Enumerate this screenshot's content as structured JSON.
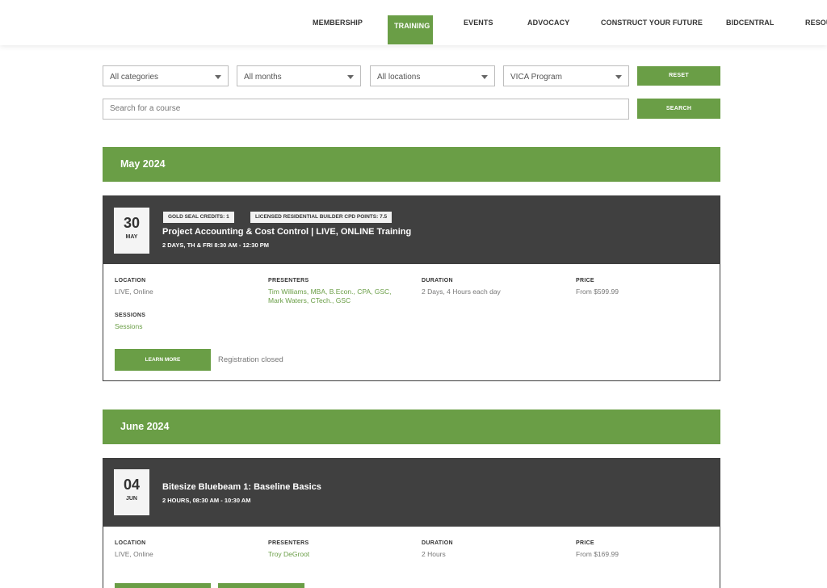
{
  "nav": {
    "items": [
      {
        "label": "MEMBERSHIP"
      },
      {
        "label": "TRAINING"
      },
      {
        "label": "EVENTS"
      },
      {
        "label": "ADVOCACY"
      },
      {
        "label": "CONSTRUCT YOUR FUTURE"
      },
      {
        "label": "BIDCENTRAL"
      },
      {
        "label": "RESOU"
      }
    ],
    "active": "TRAINING"
  },
  "filters": {
    "categories": "All categories",
    "months": "All months",
    "locations": "All locations",
    "program": "VICA Program",
    "reset_label": "RESET",
    "search_placeholder": "Search for a course",
    "search_label": "SEARCH"
  },
  "months": [
    {
      "label": "May 2024",
      "courses": [
        {
          "day": "30",
          "month": "MAY",
          "badges": [
            "GOLD SEAL CREDITS: 1",
            "LICENSED RESIDENTIAL BUILDER CPD POINTS: 7.5"
          ],
          "title": "Project Accounting & Cost Control | LIVE, ONLINE Training",
          "schedule": "2 DAYS, TH & FRI 8:30 AM - 12:30 PM",
          "location_label": "LOCATION",
          "location": "LIVE, Online",
          "presenters_label": "PRESENTERS",
          "presenters_line1": "Tim Williams, MBA, B.Econ., CPA, GSC,",
          "presenters_line2": "Mark Waters, CTech., GSC",
          "duration_label": "DURATION",
          "duration": "2 Days, 4 Hours each day",
          "price_label": "PRICE",
          "price": "From $599.99",
          "sessions_label": "SESSIONS",
          "sessions": "Sessions",
          "learn_more": "LEARN MORE",
          "status": "Registration closed"
        }
      ]
    },
    {
      "label": "June 2024",
      "courses": [
        {
          "day": "04",
          "month": "JUN",
          "title": "Bitesize Bluebeam 1: Baseline Basics",
          "schedule": "2 HOURS, 08:30 AM - 10:30 AM",
          "location_label": "LOCATION",
          "location": "LIVE, Online",
          "presenters_label": "PRESENTERS",
          "presenters": "Troy DeGroot",
          "duration_label": "DURATION",
          "duration": "2 Hours",
          "price_label": "PRICE",
          "price": "From $169.99"
        }
      ]
    }
  ],
  "colors": {
    "accent": "#6a9e46",
    "header_dark": "#404040"
  }
}
